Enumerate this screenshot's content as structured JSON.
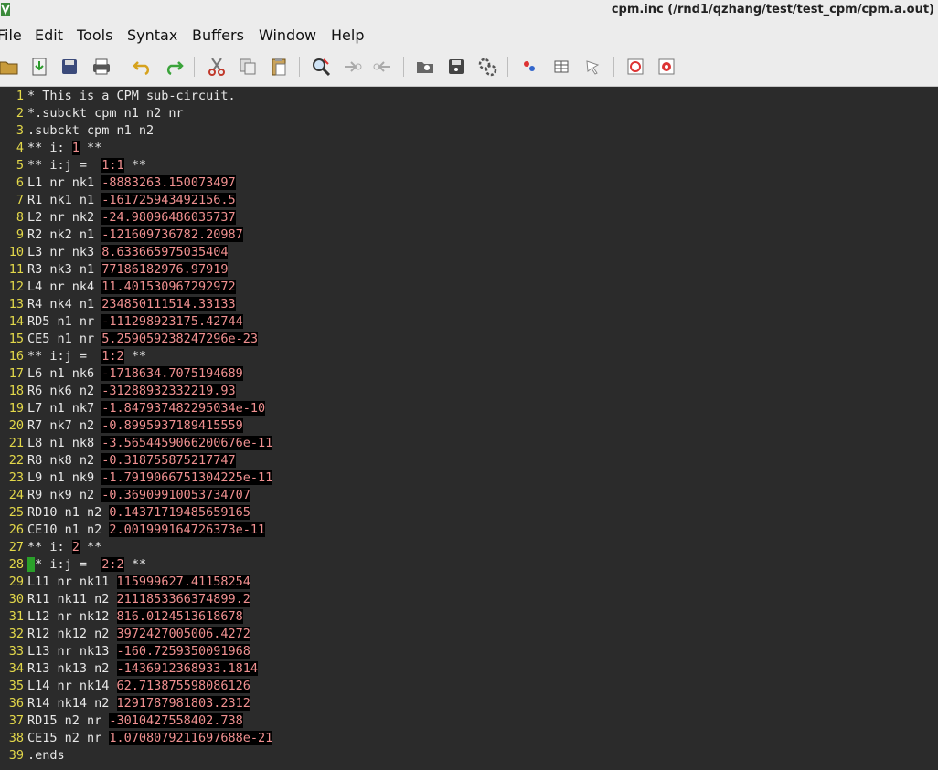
{
  "window": {
    "title": "cpm.inc (/rnd1/qzhang/test/test_cpm/cpm.a.out)"
  },
  "menu": [
    "File",
    "Edit",
    "Tools",
    "Syntax",
    "Buffers",
    "Window",
    "Help"
  ],
  "toolbar": [
    {
      "icon": "open-folder-icon"
    },
    {
      "icon": "download-icon"
    },
    {
      "icon": "save-icon"
    },
    {
      "icon": "print-icon"
    },
    {
      "icon": "undo-icon"
    },
    {
      "icon": "redo-icon"
    },
    {
      "icon": "cut-icon"
    },
    {
      "icon": "copy-icon"
    },
    {
      "icon": "paste-icon"
    },
    {
      "icon": "find-replace-icon"
    },
    {
      "icon": "find-next-icon"
    },
    {
      "icon": "find-previous-icon"
    },
    {
      "icon": "load-session-icon"
    },
    {
      "icon": "save-session-icon"
    },
    {
      "icon": "run-script-icon"
    },
    {
      "icon": "make-icon"
    },
    {
      "icon": "build-tags-icon"
    },
    {
      "icon": "jump-tag-icon"
    },
    {
      "icon": "help-icon"
    },
    {
      "icon": "find-help-icon"
    }
  ],
  "lines": [
    {
      "n": "1",
      "parts": [
        {
          "t": "* This is a CPM sub-circuit."
        }
      ]
    },
    {
      "n": "2",
      "parts": [
        {
          "t": "*.subckt cpm n1 n2 nr"
        }
      ]
    },
    {
      "n": "3",
      "parts": [
        {
          "t": ".subckt cpm n1 n2"
        }
      ]
    },
    {
      "n": "4",
      "parts": [
        {
          "t": "** i: "
        },
        {
          "t": "1",
          "c": "num"
        },
        {
          "t": " **"
        }
      ]
    },
    {
      "n": "5",
      "parts": [
        {
          "t": "** i:j =  "
        },
        {
          "t": "1:1",
          "c": "num"
        },
        {
          "t": " **"
        }
      ]
    },
    {
      "n": "6",
      "parts": [
        {
          "t": "L1 nr nk1 "
        },
        {
          "t": "-8883263.150073497",
          "c": "num"
        }
      ]
    },
    {
      "n": "7",
      "parts": [
        {
          "t": "R1 nk1 n1 "
        },
        {
          "t": "-161725943492156.5",
          "c": "num"
        }
      ]
    },
    {
      "n": "8",
      "parts": [
        {
          "t": "L2 nr nk2 "
        },
        {
          "t": "-24.98096486035737",
          "c": "num"
        }
      ]
    },
    {
      "n": "9",
      "parts": [
        {
          "t": "R2 nk2 n1 "
        },
        {
          "t": "-121609736782.20987",
          "c": "num"
        }
      ]
    },
    {
      "n": "10",
      "parts": [
        {
          "t": "L3 nr nk3 "
        },
        {
          "t": "8.633665975035404",
          "c": "num"
        }
      ]
    },
    {
      "n": "11",
      "parts": [
        {
          "t": "R3 nk3 n1 "
        },
        {
          "t": "77186182976.97919",
          "c": "num"
        }
      ]
    },
    {
      "n": "12",
      "parts": [
        {
          "t": "L4 nr nk4 "
        },
        {
          "t": "11.401530967292972",
          "c": "num"
        }
      ]
    },
    {
      "n": "13",
      "parts": [
        {
          "t": "R4 nk4 n1 "
        },
        {
          "t": "234850111514.33133",
          "c": "num"
        }
      ]
    },
    {
      "n": "14",
      "parts": [
        {
          "t": "RD5 n1 nr "
        },
        {
          "t": "-111298923175.42744",
          "c": "num"
        }
      ]
    },
    {
      "n": "15",
      "parts": [
        {
          "t": "CE5 n1 nr "
        },
        {
          "t": "5.259059238247296e-23",
          "c": "num"
        }
      ]
    },
    {
      "n": "16",
      "parts": [
        {
          "t": "** i:j =  "
        },
        {
          "t": "1:2",
          "c": "num"
        },
        {
          "t": " **"
        }
      ]
    },
    {
      "n": "17",
      "parts": [
        {
          "t": "L6 n1 nk6 "
        },
        {
          "t": "-1718634.7075194689",
          "c": "num"
        }
      ]
    },
    {
      "n": "18",
      "parts": [
        {
          "t": "R6 nk6 n2 "
        },
        {
          "t": "-31288932332219.93",
          "c": "num"
        }
      ]
    },
    {
      "n": "19",
      "parts": [
        {
          "t": "L7 n1 nk7 "
        },
        {
          "t": "-1.847937482295034e-10",
          "c": "num"
        }
      ]
    },
    {
      "n": "20",
      "parts": [
        {
          "t": "R7 nk7 n2 "
        },
        {
          "t": "-0.8995937189415559",
          "c": "num"
        }
      ]
    },
    {
      "n": "21",
      "parts": [
        {
          "t": "L8 n1 nk8 "
        },
        {
          "t": "-3.5654459066200676e-11",
          "c": "num"
        }
      ]
    },
    {
      "n": "22",
      "parts": [
        {
          "t": "R8 nk8 n2 "
        },
        {
          "t": "-0.318755875217747",
          "c": "num"
        }
      ]
    },
    {
      "n": "23",
      "parts": [
        {
          "t": "L9 n1 nk9 "
        },
        {
          "t": "-1.7919066751304225e-11",
          "c": "num"
        }
      ]
    },
    {
      "n": "24",
      "parts": [
        {
          "t": "R9 nk9 n2 "
        },
        {
          "t": "-0.36909910053734707",
          "c": "num"
        }
      ]
    },
    {
      "n": "25",
      "parts": [
        {
          "t": "RD10 n1 n2 "
        },
        {
          "t": "0.14371719485659165",
          "c": "num"
        }
      ]
    },
    {
      "n": "26",
      "parts": [
        {
          "t": "CE10 n1 n2 "
        },
        {
          "t": "2.001999164726373e-11",
          "c": "num"
        }
      ]
    },
    {
      "n": "27",
      "parts": [
        {
          "t": "** i: "
        },
        {
          "t": "2",
          "c": "num"
        },
        {
          "t": " **"
        }
      ]
    },
    {
      "n": "28",
      "parts": [
        {
          "t": "*",
          "c": "cursor"
        },
        {
          "t": "* i:j =  "
        },
        {
          "t": "2:2",
          "c": "num"
        },
        {
          "t": " **"
        }
      ]
    },
    {
      "n": "29",
      "parts": [
        {
          "t": "L11 nr nk11 "
        },
        {
          "t": "115999627.41158254",
          "c": "num"
        }
      ]
    },
    {
      "n": "30",
      "parts": [
        {
          "t": "R11 nk11 n2 "
        },
        {
          "t": "2111853366374899.2",
          "c": "num"
        }
      ]
    },
    {
      "n": "31",
      "parts": [
        {
          "t": "L12 nr nk12 "
        },
        {
          "t": "816.0124513618678",
          "c": "num"
        }
      ]
    },
    {
      "n": "32",
      "parts": [
        {
          "t": "R12 nk12 n2 "
        },
        {
          "t": "3972427005006.4272",
          "c": "num"
        }
      ]
    },
    {
      "n": "33",
      "parts": [
        {
          "t": "L13 nr nk13 "
        },
        {
          "t": "-160.7259350091968",
          "c": "num"
        }
      ]
    },
    {
      "n": "34",
      "parts": [
        {
          "t": "R13 nk13 n2 "
        },
        {
          "t": "-1436912368933.1814",
          "c": "num"
        }
      ]
    },
    {
      "n": "35",
      "parts": [
        {
          "t": "L14 nr nk14 "
        },
        {
          "t": "62.71387559808612​6",
          "c": "num"
        }
      ]
    },
    {
      "n": "36",
      "parts": [
        {
          "t": "R14 nk14 n2 "
        },
        {
          "t": "1291787981803.2312",
          "c": "num"
        }
      ]
    },
    {
      "n": "37",
      "parts": [
        {
          "t": "RD15 n2 nr "
        },
        {
          "t": "-3010427558402.738",
          "c": "num"
        }
      ]
    },
    {
      "n": "38",
      "parts": [
        {
          "t": "CE15 n2 nr "
        },
        {
          "t": "1.0708079211697688e-21",
          "c": "num"
        }
      ]
    },
    {
      "n": "39",
      "parts": [
        {
          "t": ".ends"
        }
      ]
    }
  ]
}
